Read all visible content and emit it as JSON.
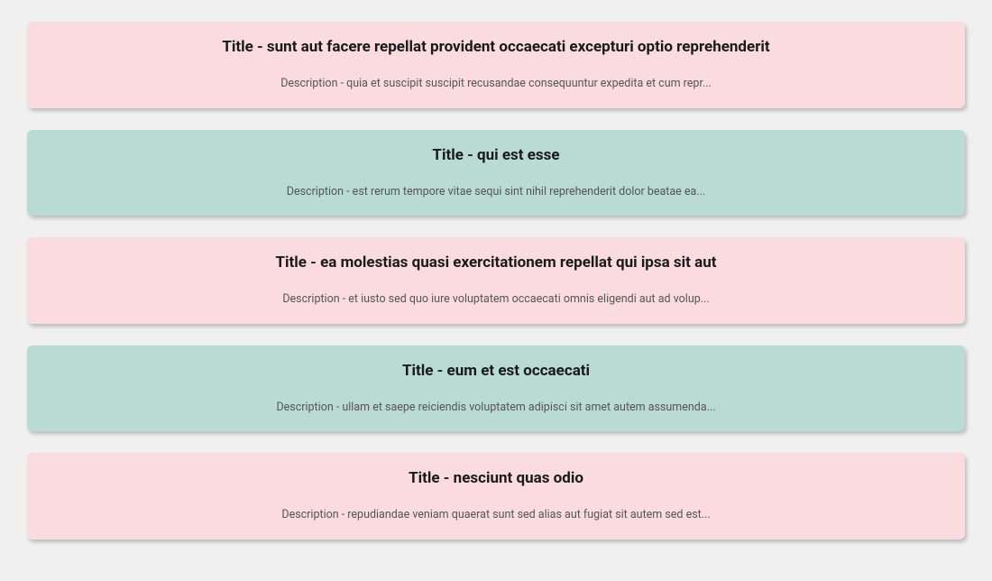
{
  "posts": [
    {
      "title": "Title - sunt aut facere repellat provident occaecati excepturi optio reprehenderit",
      "description": "Description - quia et suscipit suscipit recusandae consequuntur expedita et cum repr...",
      "color": "pink"
    },
    {
      "title": "Title - qui est esse",
      "description": "Description - est rerum tempore vitae sequi sint nihil reprehenderit dolor beatae ea...",
      "color": "teal"
    },
    {
      "title": "Title - ea molestias quasi exercitationem repellat qui ipsa sit aut",
      "description": "Description - et iusto sed quo iure voluptatem occaecati omnis eligendi aut ad volup...",
      "color": "pink"
    },
    {
      "title": "Title - eum et est occaecati",
      "description": "Description - ullam et saepe reiciendis voluptatem adipisci sit amet autem assumenda...",
      "color": "teal"
    },
    {
      "title": "Title - nesciunt quas odio",
      "description": "Description - repudiandae veniam quaerat sunt sed alias aut fugiat sit autem sed est...",
      "color": "pink"
    }
  ]
}
